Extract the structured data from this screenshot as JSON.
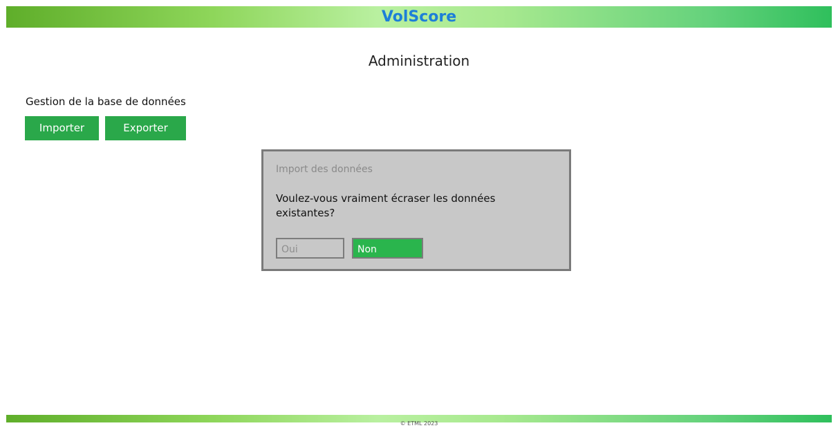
{
  "header": {
    "app_title": "VolScore"
  },
  "page": {
    "title": "Administration"
  },
  "database": {
    "section_label": "Gestion de la base de données",
    "import_label": "Importer",
    "export_label": "Exporter"
  },
  "dialog": {
    "title": "Import des données",
    "message": "Voulez-vous vraiment écraser les données existantes?",
    "yes_label": "Oui",
    "no_label": "Non"
  },
  "footer": {
    "text": "© ETML 2023"
  },
  "colors": {
    "accent_green": "#2aa84a",
    "title_blue": "#1d7fd8",
    "dialog_bg": "#c8c8c8"
  }
}
